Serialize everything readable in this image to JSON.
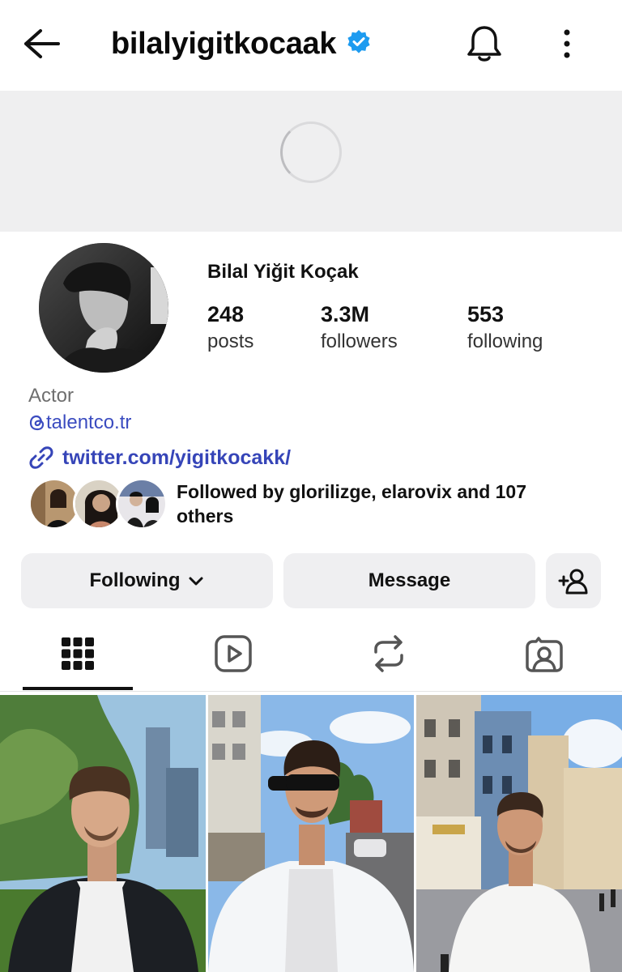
{
  "header": {
    "username": "bilalyigitkocaak",
    "verified": true,
    "accent": "#1d9bf0"
  },
  "profile": {
    "full_name": "Bilal Yiğit Koçak",
    "stats": [
      {
        "value": "248",
        "label": "posts"
      },
      {
        "value": "3.3M",
        "label": "followers"
      },
      {
        "value": "553",
        "label": "following"
      }
    ],
    "category": "Actor",
    "threads_handle": "talentco.tr",
    "link": "twitter.com/yigitkocakk/",
    "followed_by": "Followed by glorilizge, elarovix and 107 others"
  },
  "actions": {
    "following_label": "Following",
    "message_label": "Message"
  },
  "tabs": [
    {
      "icon": "grid-icon",
      "active": true
    },
    {
      "icon": "reels-icon",
      "active": false
    },
    {
      "icon": "reposts-icon",
      "active": false
    },
    {
      "icon": "tagged-icon",
      "active": false
    }
  ],
  "colors": {
    "link": "#3645b8",
    "button_bg": "#efeff1",
    "banner_bg": "#efeff0"
  }
}
